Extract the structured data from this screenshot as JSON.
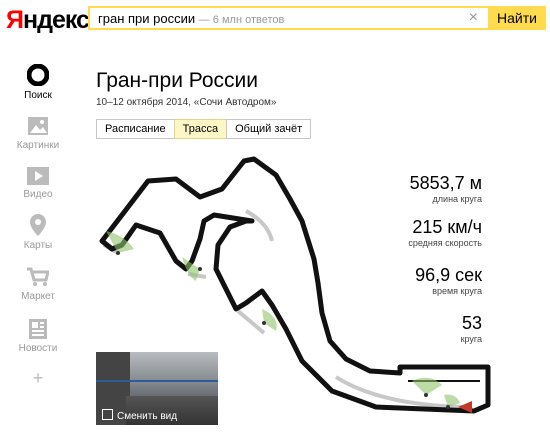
{
  "header": {
    "logo_first": "Я",
    "logo_rest": "ндекс",
    "query": "гран при россии",
    "hint": "— 6 млн ответов",
    "find_label": "Найти"
  },
  "sidebar": {
    "items": [
      {
        "label": "Поиск",
        "icon": "search-icon"
      },
      {
        "label": "Картинки",
        "icon": "images-icon"
      },
      {
        "label": "Видео",
        "icon": "video-icon"
      },
      {
        "label": "Карты",
        "icon": "map-pin-icon"
      },
      {
        "label": "Маркет",
        "icon": "cart-icon"
      },
      {
        "label": "Новости",
        "icon": "news-icon"
      }
    ],
    "more": "+"
  },
  "event": {
    "title": "Гран-при России",
    "subtitle": "10–12 октября 2014, «Сочи Автодром»",
    "tabs": [
      "Расписание",
      "Трасса",
      "Общий зачёт"
    ],
    "active_tab": "Трасса"
  },
  "stats": [
    {
      "value": "5853,7 м",
      "label": "длина круга"
    },
    {
      "value": "215 км/ч",
      "label": "средняя скорость"
    },
    {
      "value": "96,9 сек",
      "label": "время круга"
    },
    {
      "value": "53",
      "label": "круга"
    }
  ],
  "thumbnail": {
    "caption": "Сменить вид"
  },
  "colors": {
    "accent": "#ffdb4d",
    "logo_red": "#ff0000",
    "track": "#111111",
    "camera_green": "#8fc36b",
    "start_arrow": "#c0392b"
  }
}
